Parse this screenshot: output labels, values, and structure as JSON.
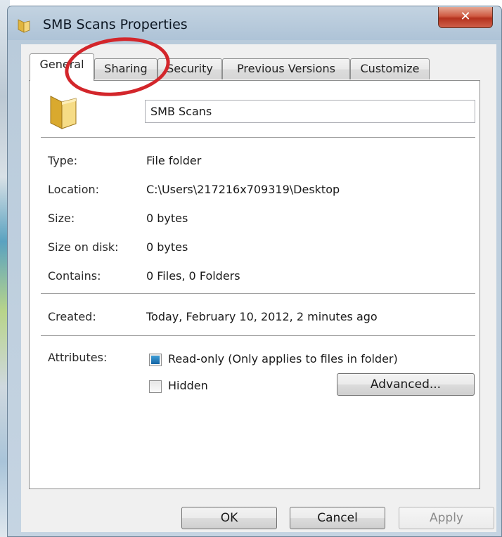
{
  "window": {
    "title": "SMB Scans Properties",
    "close_label": "✕"
  },
  "tabs": [
    {
      "label": "General",
      "active": true
    },
    {
      "label": "Sharing",
      "active": false
    },
    {
      "label": "Security",
      "active": false
    },
    {
      "label": "Previous Versions",
      "active": false
    },
    {
      "label": "Customize",
      "active": false
    }
  ],
  "general": {
    "folder_name": "SMB Scans",
    "properties": [
      {
        "label": "Type:",
        "value": "File folder"
      },
      {
        "label": "Location:",
        "value": "C:\\Users\\217216x709319\\Desktop"
      },
      {
        "label": "Size:",
        "value": "0 bytes"
      },
      {
        "label": "Size on disk:",
        "value": "0 bytes"
      },
      {
        "label": "Contains:",
        "value": "0 Files, 0 Folders"
      }
    ],
    "created": {
      "label": "Created:",
      "value": "Today, February 10, 2012, 2 minutes ago"
    },
    "attributes": {
      "label": "Attributes:",
      "read_only": {
        "label": "Read-only (Only applies to files in folder)",
        "state": "indeterminate"
      },
      "hidden": {
        "label": "Hidden",
        "checked": false
      },
      "advanced_label": "Advanced..."
    }
  },
  "footer": {
    "ok_label": "OK",
    "cancel_label": "Cancel",
    "apply_label": "Apply",
    "apply_enabled": false
  },
  "colors": {
    "annotation_circle": "#d3262b",
    "close_button": "#c8432c"
  },
  "icons": {
    "title": "folder-icon",
    "panel": "folder-icon",
    "close": "close-icon"
  }
}
